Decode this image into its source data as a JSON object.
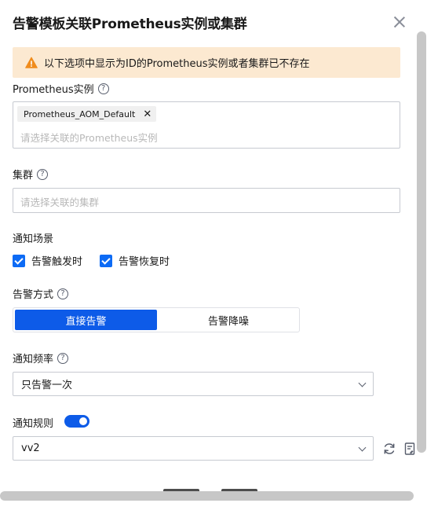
{
  "dialog": {
    "title": "告警模板关联Prometheus实例或集群",
    "alert_text": "以下选项中显示为ID的Prometheus实例或者集群已不存在"
  },
  "prometheus": {
    "label": "Prometheus实例",
    "tag": "Prometheus_AOM_Default",
    "placeholder": "请选择关联的Prometheus实例"
  },
  "cluster": {
    "label": "集群",
    "placeholder": "请选择关联的集群"
  },
  "scene": {
    "label": "通知场景",
    "options": [
      {
        "label": "告警触发时",
        "checked": true
      },
      {
        "label": "告警恢复时",
        "checked": true
      }
    ]
  },
  "method": {
    "label": "告警方式",
    "options": [
      "直接告警",
      "告警降噪"
    ],
    "selected": "直接告警"
  },
  "frequency": {
    "label": "通知频率",
    "value": "只告警一次"
  },
  "rule": {
    "label": "通知规则",
    "enabled": true,
    "value": "vv2"
  },
  "colors": {
    "accent": "#0d5be8",
    "alert_bg": "#fce9d1",
    "warning": "#f08c1d"
  },
  "icons": [
    "close-icon",
    "warning-icon",
    "help-icon",
    "chevron-down-icon",
    "refresh-icon",
    "edit-rule-icon"
  ]
}
